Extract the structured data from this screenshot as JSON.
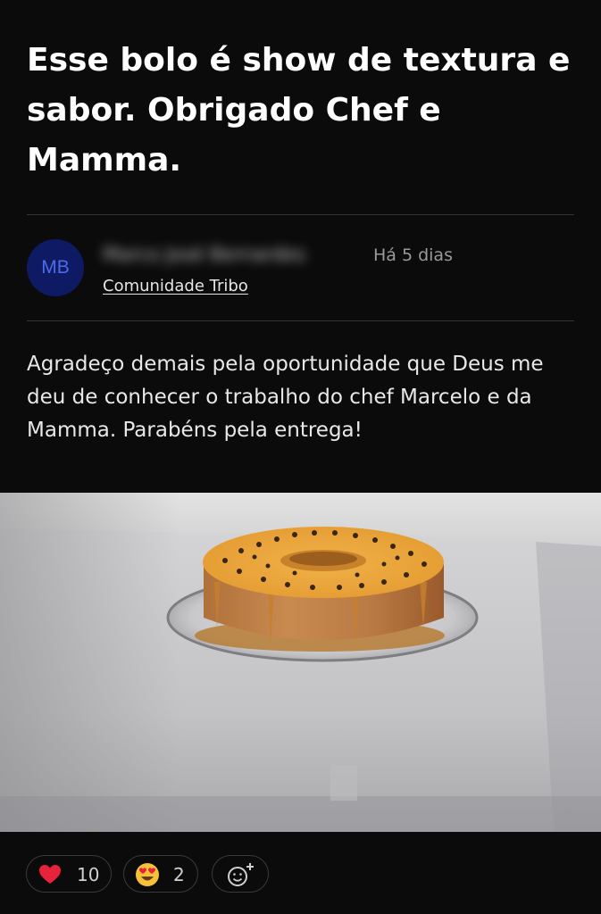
{
  "post": {
    "title": "Esse bolo é show de textura e sabor. Obrigado Chef e Mamma.",
    "author": {
      "initials": "MB",
      "name": "Marco José Bernardes",
      "time": "Há 5 dias",
      "community": "Comunidade Tribo"
    },
    "body": "Agradeço demais pela oportunidade que Deus me deu de conhecer o trabalho do chef Marcelo e da Mamma. Parabéns pela entrega!"
  },
  "reactions": {
    "heart_count": "10",
    "love_count": "2"
  },
  "icons": {
    "heart": "heart-icon",
    "love": "heart-eyes-emoji-icon",
    "add_reaction": "add-reaction-icon"
  },
  "colors": {
    "background": "#0b0b0b",
    "avatar_bg": "#0e1a63",
    "avatar_text": "#4f6ae8",
    "heart": "#e8223a",
    "emoji": "#f7c23a"
  }
}
